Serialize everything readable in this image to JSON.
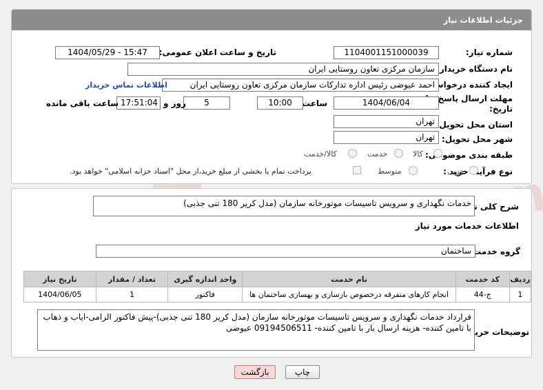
{
  "header": {
    "title": "جزئیات اطلاعات نیاز"
  },
  "need_number": {
    "label": "شماره نیاز:",
    "value": "1104001151000039"
  },
  "announce": {
    "label": "تاریخ و ساعت اعلان عمومی:",
    "value": "1404/05/29 - 15:47"
  },
  "buyer_org": {
    "label": "نام دستگاه خریدار:",
    "value": "سازمان مرکزی تعاون روستایی ایران"
  },
  "requester": {
    "label": "ایجاد کننده درخواست:",
    "value": "احمد عیوضی رئیس اداره تدارکات سازمان مرکزی تعاون روستایی ایران",
    "contact_link": "اطلاعات تماس خریدار"
  },
  "deadline": {
    "label_line1": "مهلت ارسال پاسخ: تا",
    "label_line2": "تاریخ:",
    "date": "1404/06/04",
    "time_label": "ساعت",
    "time": "10:00",
    "days": "5",
    "days_label": "روز و",
    "remaining": "17:51:04",
    "remaining_label": "ساعت باقی مانده"
  },
  "province": {
    "label": "استان محل تحویل:",
    "value": "تهران"
  },
  "city": {
    "label": "شهر محل تحویل:",
    "value": "تهران"
  },
  "category": {
    "label": "طبقه بندی موضوعی:",
    "options": [
      "کالا",
      "خدمت",
      "کالا/خدمت"
    ]
  },
  "process": {
    "label": "نوع فرآیند خرید :",
    "options": [
      "جزیی",
      "متوسط"
    ],
    "payment_note": "پرداخت تمام یا بخشی از مبلغ خرید،از محل \"اسناد خزانه اسلامی\" خواهد بود."
  },
  "description": {
    "label": "شرح کلی نیاز:",
    "value": "خدمات نگهداری و سرویس تاسیسات موتورخانه سازمان (مدل کریر 180 تنی جذبی)"
  },
  "services": {
    "title": "اطلاعات خدمات مورد نیاز",
    "group_label": "گروه خدمت:",
    "group_value": "ساختمان",
    "columns": [
      "ردیف",
      "کد خدمت",
      "نام خدمت",
      "واحد اندازه گیری",
      "تعداد / مقدار",
      "تاریخ نیاز"
    ],
    "rows": [
      {
        "row": "1",
        "code": "ج-44",
        "name": "انجام کارهای متفرقه درخصوص بازسازی و بهسازی ساختمان ها",
        "unit": "فاکتور",
        "qty": "1",
        "date": "1404/06/05"
      }
    ]
  },
  "buyer_notes": {
    "label": "توضیحات خریدار:",
    "value": "قرارداد خدمات نگهداری و سرویس تاسیسات موتورخانه سازمان (مدل کریر 180 تنی جذبی)-پیش فاکتور الزامی-ایاب و ذهاب با تامین کننده- هزینه ارسال بار با تامین کننده- 09194506511 عیوضی"
  },
  "buttons": {
    "print": "چاپ",
    "back": "بازگشت"
  },
  "watermark": {
    "text": "AriaTender.neT"
  }
}
